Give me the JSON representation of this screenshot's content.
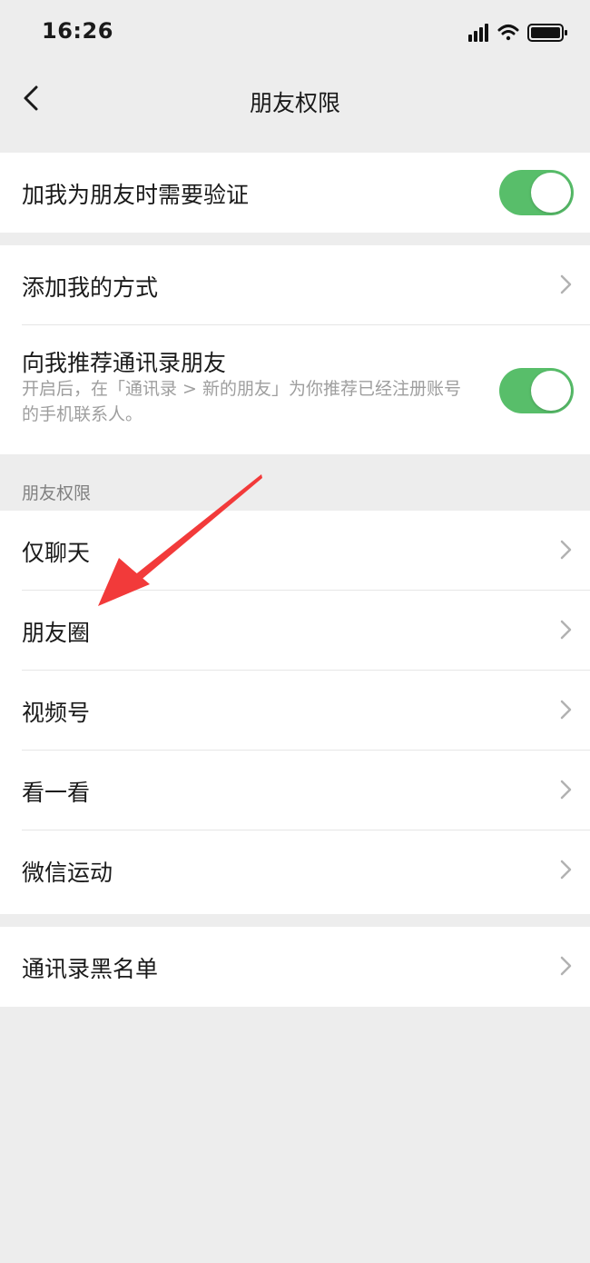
{
  "status_bar": {
    "time": "16:26"
  },
  "nav": {
    "title": "朋友权限"
  },
  "groups": {
    "verify": {
      "label": "加我为朋友时需要验证",
      "enabled": true
    },
    "add_methods": {
      "label": "添加我的方式"
    },
    "recommend": {
      "label": "向我推荐通讯录朋友",
      "description": "开启后，在「通讯录 > 新的朋友」为你推荐已经注册账号的手机联系人。",
      "enabled": true
    }
  },
  "permissions": {
    "header": "朋友权限",
    "items": [
      {
        "label": "仅聊天"
      },
      {
        "label": "朋友圈"
      },
      {
        "label": "视频号"
      },
      {
        "label": "看一看"
      },
      {
        "label": "微信运动"
      }
    ]
  },
  "blacklist": {
    "label": "通讯录黑名单"
  },
  "colors": {
    "accent": "#58be6a",
    "background": "#ededed",
    "annotation_arrow": "#f23a3a"
  },
  "icons": {
    "back": "chevron-left-icon",
    "row_arrow": "chevron-right-icon",
    "signal": "signal-icon",
    "wifi": "wifi-icon",
    "battery": "battery-icon"
  }
}
